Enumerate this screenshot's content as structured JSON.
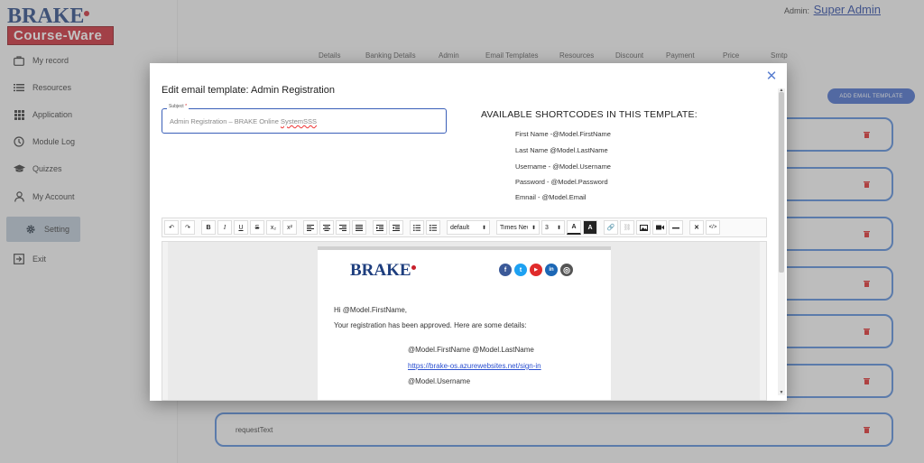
{
  "brand": {
    "logo_top": "BRAKE",
    "logo_bottom": "Course-Ware"
  },
  "sidebar": {
    "items": [
      {
        "label": "My record",
        "icon": "briefcase-icon"
      },
      {
        "label": "Resources",
        "icon": "list-icon"
      },
      {
        "label": "Application",
        "icon": "grid-icon"
      },
      {
        "label": "Module Log",
        "icon": "clock-icon"
      },
      {
        "label": "Quizzes",
        "icon": "graduation-cap-icon"
      },
      {
        "label": "My Account",
        "icon": "user-icon"
      },
      {
        "label": "Setting",
        "icon": "gear-icon"
      },
      {
        "label": "Exit",
        "icon": "exit-icon"
      }
    ]
  },
  "header": {
    "admin_prefix": "Admin:",
    "admin_name": "Super Admin"
  },
  "tabs": [
    "Details",
    "Banking Details",
    "Admin",
    "Email Templates",
    "Resources",
    "Discount",
    "Payment",
    "Price",
    "Smtp"
  ],
  "add_button": "ADD EMAIL TEMPLATE",
  "template_list": {
    "visible_item": "requestText"
  },
  "modal": {
    "title": "Edit email template: Admin Registration",
    "subject": {
      "label": "Subject",
      "required_mark": "*",
      "value_prefix": "Admin Registration – BRAKE Online ",
      "value_misspelled": "SystemSSS"
    },
    "shortcodes": {
      "title": "AVAILABLE SHORTCODES IN THIS TEMPLATE:",
      "items": [
        "First Name -@Model.FirstName",
        "Last Name @Model.LastName",
        "Username - @Model.Username",
        "Password - @Model.Password",
        "Emnail - @Model.Email"
      ]
    },
    "toolbar": {
      "undo": "↶",
      "redo": "↷",
      "bold": "B",
      "italic": "I",
      "underline": "U",
      "strike": "S",
      "subscript": "x₂",
      "superscript": "x²",
      "style_select": "default",
      "font_select": "Times New R",
      "size_select": "3",
      "font_color": "A",
      "highlight": "A",
      "remove_format": "✕",
      "code_view": "</>"
    },
    "email_preview": {
      "logo": "BRAKE",
      "greeting": "Hi @Model.FirstName,",
      "intro": "Your registration has been approved. Here are some details:",
      "name_line": "@Model.FirstName @Model.LastName",
      "link": "https://brake-os.azurewebsites.net/sign-in",
      "username_line": "@Model.Username",
      "social": [
        {
          "name": "facebook",
          "glyph": "f",
          "color": "#3b5998"
        },
        {
          "name": "twitter",
          "glyph": "t",
          "color": "#1da1f2"
        },
        {
          "name": "youtube",
          "glyph": "▶",
          "color": "#e02b2b"
        },
        {
          "name": "linkedin",
          "glyph": "in",
          "color": "#1c67b5"
        },
        {
          "name": "instagram",
          "glyph": "◎",
          "color": "#555555"
        }
      ]
    }
  },
  "colors": {
    "primary": "#3f67c8",
    "brand_red": "#c8202c",
    "brand_blue": "#1e3e7e",
    "card_border": "#4f86d8"
  }
}
